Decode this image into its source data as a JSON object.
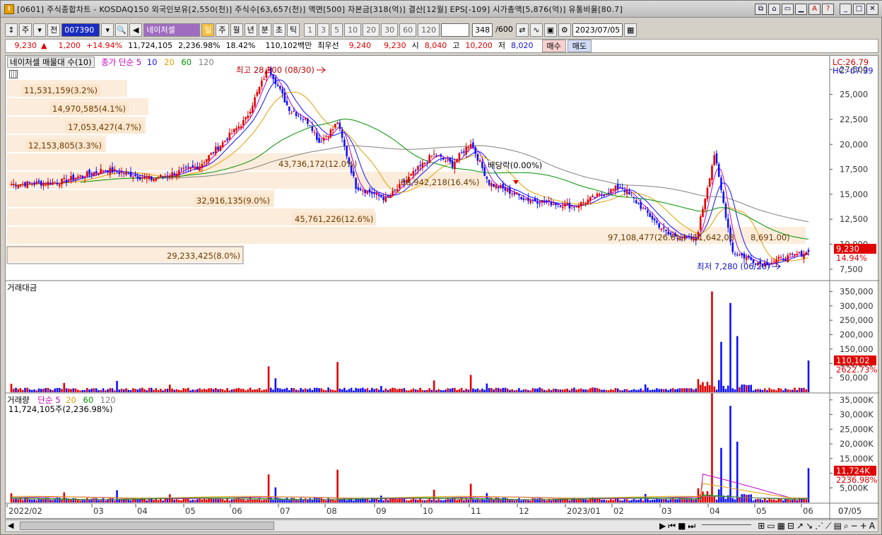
{
  "window": {
    "title": "[0601] 주식종합차트 - KOSDAQ150 외국인보유[2,550(천)] 주식수[63,657(천)] 액면[500] 자본금[318(억)] 결산[12월] EPS[-109] 시가총액[5,876(억)] 유통비율[80.7]",
    "app_icon": "I"
  },
  "toolbar": {
    "market": "주",
    "scope": "전",
    "code": "007390",
    "stock_name": "네이처셀",
    "period_buttons": [
      "일",
      "주",
      "월",
      "년",
      "분",
      "초",
      "틱"
    ],
    "interval_buttons": [
      "1",
      "3",
      "5",
      "10",
      "20",
      "30",
      "60",
      "120"
    ],
    "count": "348",
    "count_max": "/600",
    "date": "2023/07/05"
  },
  "quote": {
    "price": "9,230",
    "change": "1,200",
    "change_pct": "+14.94%",
    "volume": "11,724,105",
    "volume_ratio": "2,236.98%",
    "turnover": "18.42%",
    "amount": "110,102백만",
    "ask_label": "최우선",
    "ask": "9,240",
    "bid": "9,230",
    "open_label": "시",
    "open": "8,040",
    "high_label": "고",
    "high": "10,200",
    "low_label": "저",
    "low": "8,020",
    "buy_label": "매수",
    "sell_label": "매도"
  },
  "price_panel": {
    "legend_title": "네이처셀 매물대 수(10)",
    "legend_ma": "종가 단순 5",
    "ma_periods": [
      "10",
      "20",
      "60",
      "120"
    ],
    "ma_colors": [
      "#c000c0",
      "#1010ff",
      "#e0a000",
      "#009000",
      "#808080"
    ],
    "lc": "LC:26.79",
    "hc": "HC:-67.39",
    "y_ticks": [
      "27,500",
      "25,000",
      "22,500",
      "20,000",
      "17,500",
      "15,000",
      "12,500",
      "10,000",
      "7,500"
    ],
    "current_price_tag": "9,230",
    "current_pct_tag": "14.94%",
    "high_note": "최고 28,300 (08/30)",
    "low_note": "최저 7,280 (06/20)",
    "dividend_note": "배당락(0.00%)",
    "volume_profile": [
      {
        "label": "11,531,159(3.2%)"
      },
      {
        "label": "14,970,585(4.1%)"
      },
      {
        "label": "17,053,427(4.7%)"
      },
      {
        "label": "12,153,805(3.3%)"
      },
      {
        "label": "43,736,172(12.0%)"
      },
      {
        "label": "58,942,218(16.4%)"
      },
      {
        "label": "32,916,135(9.0%)"
      },
      {
        "label": "45,761,226(12.6%)"
      },
      {
        "label": "97,108,477(26.6%)"
      },
      {
        "label": "29,233,425(8.0%)"
      }
    ],
    "overlap_note": "(11,642,08",
    "overlap_note2": "8,691.00)"
  },
  "amount_panel": {
    "legend": "거래대금",
    "y_ticks": [
      "350,000",
      "300,000",
      "250,000",
      "200,000",
      "150,000",
      "100,000",
      "50,000"
    ],
    "tag": "110,102",
    "tag_pct": "2622.73%"
  },
  "volume_panel": {
    "legend": "거래량",
    "legend_ma": "단순 5",
    "ma_periods": [
      "20",
      "60",
      "120"
    ],
    "sub": "11,724,105주(2,236.98%)",
    "y_ticks": [
      "35,000K",
      "30,000K",
      "25,000K",
      "20,000K",
      "15,000K",
      "10,000K",
      "5,000K"
    ],
    "tag": "11,724K",
    "tag_pct": "2236.98%"
  },
  "x_axis": {
    "labels": [
      "2022/02",
      "03",
      "04",
      "05",
      "06",
      "07",
      "08",
      "09",
      "10",
      "11",
      "12",
      "2023/01",
      "02",
      "03",
      "04",
      "05",
      "06",
      "07",
      "07/05"
    ]
  },
  "chart_data": {
    "type": "candlestick",
    "symbol": "007390",
    "name": "네이처셀",
    "y_range": [
      6500,
      28300
    ],
    "monthly_closes": [
      {
        "month": "2022/02",
        "close": 16000
      },
      {
        "month": "2022/03",
        "close": 16200
      },
      {
        "month": "2022/04",
        "close": 17500
      },
      {
        "month": "2022/05",
        "close": 16500
      },
      {
        "month": "2022/06",
        "close": 17800
      },
      {
        "month": "2022/07",
        "close": 22500
      },
      {
        "month": "2022/08",
        "close": 23000
      },
      {
        "month": "2022/09",
        "close": 16500
      },
      {
        "month": "2022/10",
        "close": 14500
      },
      {
        "month": "2022/11",
        "close": 19000
      },
      {
        "month": "2022/12",
        "close": 16500
      },
      {
        "month": "2023/01",
        "close": 14500
      },
      {
        "month": "2023/02",
        "close": 13800
      },
      {
        "month": "2023/03",
        "close": 15800
      },
      {
        "month": "2023/04",
        "close": 11000
      },
      {
        "month": "2023/05",
        "close": 10000
      },
      {
        "month": "2023/06",
        "close": 8000
      },
      {
        "month": "2023/07",
        "close": 9230
      }
    ],
    "max": {
      "value": 28300,
      "date": "08/30"
    },
    "min": {
      "value": 7280,
      "date": "06/20"
    },
    "last": {
      "value": 9230,
      "date": "2023/07/05"
    },
    "amount_max": 350000,
    "volume_max_k": 35000
  }
}
